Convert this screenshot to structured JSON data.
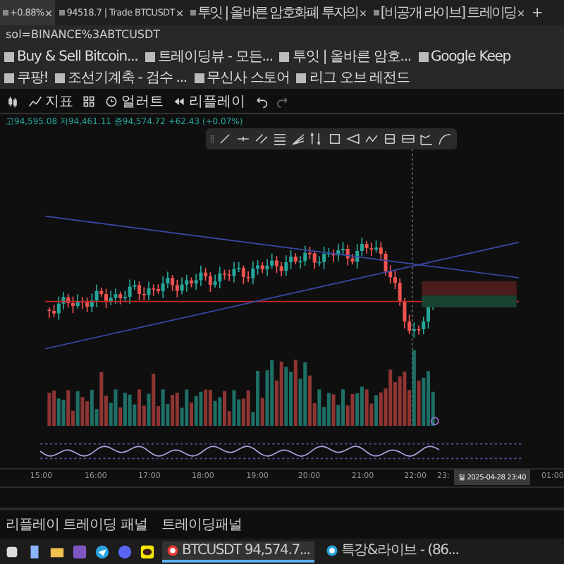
{
  "browser_tabs": [
    {
      "label": "+0.88%",
      "selected": true
    },
    {
      "label": "94518.7 | Trade BTCUSDT",
      "selected": false
    },
    {
      "label": "투잇 | 올바른 암호화폐 투자의",
      "selected": false
    },
    {
      "label": "[비공개 라이브] 트레이딩",
      "selected": false
    }
  ],
  "new_tab": "+",
  "address": "sol=BINANCE%3ABTCUSDT",
  "bookmarks": [
    "Buy & Sell Bitcoin...",
    "트레이딩뷰 - 모든...",
    "투잇 | 올바른 암호...",
    "Google Keep",
    "쿠팡!",
    "조선기계축 - 검수 ...",
    "무신사 스토어",
    "리그 오브 레전드"
  ],
  "toolbar": {
    "indicators": "지표",
    "alerts": "얼러트",
    "replay": "리플레이"
  },
  "ohlc": "고94,595.08 저94,461.11 종94,574.72 +62.43 (+0.07%)",
  "time_axis": [
    "15:00",
    "16:00",
    "17:00",
    "18:00",
    "19:00",
    "20:00",
    "21:00",
    "22:00",
    "23:"
  ],
  "crosshair_time": "월 2025-04-28  23:40",
  "next_time": "01:00",
  "panel_tabs": [
    "리플레이 트레이딩 패널",
    "트레이딩패널"
  ],
  "taskbar_windows": [
    {
      "label": "BTCUSDT 94,574.7...",
      "selected": true
    },
    {
      "label": "특강&라이브 - (86...",
      "selected": false
    }
  ]
}
